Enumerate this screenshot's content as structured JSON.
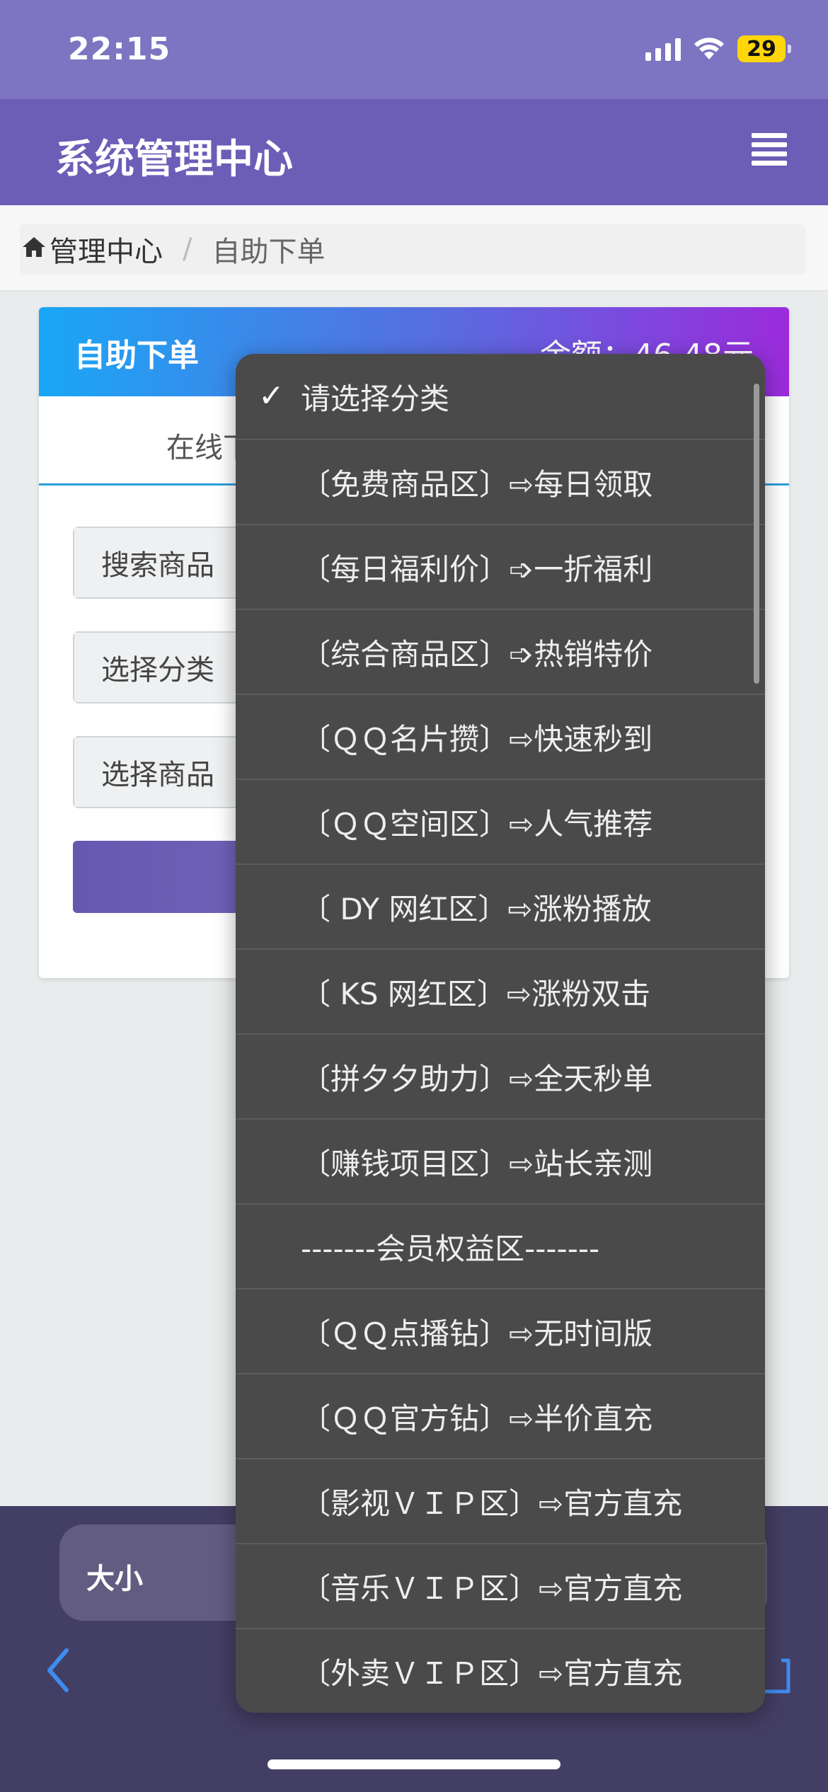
{
  "status_bar": {
    "time": "22:15",
    "battery": "29"
  },
  "header": {
    "title": "系统管理中心"
  },
  "breadcrumb": {
    "home": "管理中心",
    "separator": "/",
    "current": "自助下单"
  },
  "card": {
    "title": "自助下单",
    "balance": "余额：46.48元",
    "tab_online": "在线下",
    "fields": {
      "search_label": "搜索商品",
      "category_label": "选择分类",
      "product_label": "选择商品"
    }
  },
  "bottom_bar": {
    "font_size_label": "大小"
  },
  "dropdown": {
    "selected": "请选择分类",
    "options": [
      "请选择分类",
      "〔免费商品区〕⇨每日领取",
      "〔每日福利价〕➩一折福利",
      "〔综合商品区〕➩热销特价",
      "〔ＱＱ名片攒〕⇨快速秒到",
      "〔ＱＱ空间区〕⇨人气推荐",
      "〔 DY 网红区〕⇨涨粉播放",
      "〔 KS 网红区〕⇨涨粉双击",
      "〔拼夕夕助力〕⇨全天秒单",
      "〔赚钱项目区〕⇨站长亲测",
      "-------会员权益区-------",
      "〔ＱＱ点播钻〕⇨无时间版",
      "〔ＱＱ官方钻〕⇨半价直充",
      "〔影视ＶＩＰ区〕⇨官方直充",
      "〔音乐ＶＩＰ区〕⇨官方直充",
      "〔外卖ＶＩＰ区〕⇨官方直充"
    ]
  },
  "colors": {
    "header": "#6c5db7",
    "status_bar": "#7d74c2",
    "card_gradient_start": "#1aa7f5",
    "card_gradient_end": "#9b2bdc",
    "dropdown_bg": "#4a4a4a",
    "bottom_bar": "#433e63"
  }
}
